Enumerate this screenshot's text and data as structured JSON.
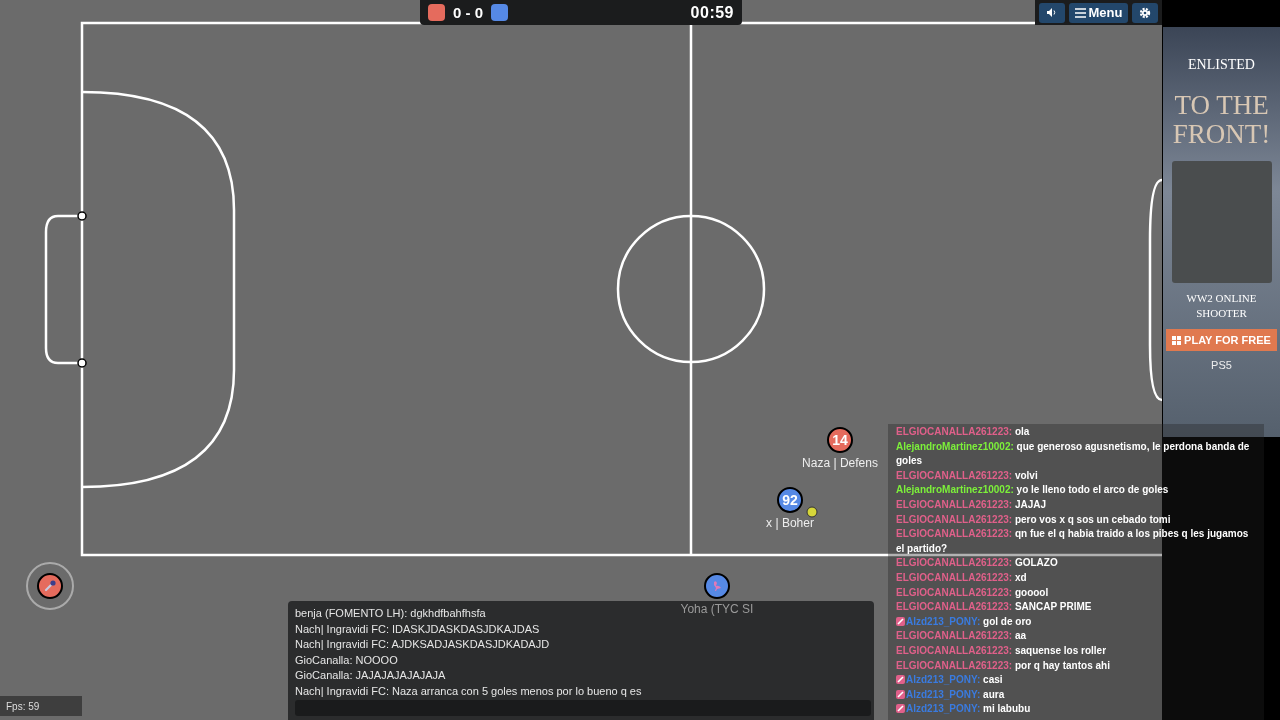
{
  "scoreboard": {
    "red_score": "0",
    "separator": "-",
    "blue_score": "0",
    "time": "00:59"
  },
  "top_buttons": [
    {
      "kind": "sound"
    },
    {
      "kind": "menu",
      "label": "Menu"
    },
    {
      "kind": "settings"
    }
  ],
  "players": [
    {
      "color": "#e56b5d",
      "number": "14",
      "name": "Naza | Defens"
    },
    {
      "color": "#5689e5",
      "number": "92",
      "name": "x | Boher"
    },
    {
      "color": "#5689e5",
      "name": "Yoha (TYC SI"
    },
    {
      "color": "#e56b5d",
      "local": true
    }
  ],
  "ad": {
    "brand": "ENLISTED",
    "headline": "TO THE FRONT!",
    "tagline": "WW2 ONLINE SHOOTER",
    "cta": "PLAY FOR FREE",
    "platform": "PS5"
  },
  "room_chat": [
    {
      "name": "ELGIOCANALLA261223:",
      "text": "ola",
      "color": "#e0608a",
      "badge": false
    },
    {
      "name": "AlejandroMartinez10002:",
      "text": "que generoso agusnetismo, le perdona banda de goles",
      "color": "#7cf03a",
      "badge": false
    },
    {
      "name": "ELGIOCANALLA261223:",
      "text": "volvi",
      "color": "#e0608a",
      "badge": false
    },
    {
      "name": "AlejandroMartinez10002:",
      "text": "yo le lleno todo el arco de goles",
      "color": "#7cf03a",
      "badge": false
    },
    {
      "name": "ELGIOCANALLA261223:",
      "text": "JAJAJ",
      "color": "#e0608a",
      "badge": false
    },
    {
      "name": "ELGIOCANALLA261223:",
      "text": "pero vos x q sos un cebado tomi",
      "color": "#e0608a",
      "badge": false
    },
    {
      "name": "ELGIOCANALLA261223:",
      "text": "qn fue el q habia traido a los pibes q les jugamos el partido?",
      "color": "#e0608a",
      "badge": false
    },
    {
      "name": "ELGIOCANALLA261223:",
      "text": "GOLAZO",
      "color": "#e0608a",
      "badge": false
    },
    {
      "name": "ELGIOCANALLA261223:",
      "text": "xd",
      "color": "#e0608a",
      "badge": false
    },
    {
      "name": "ELGIOCANALLA261223:",
      "text": "gooool",
      "color": "#e0608a",
      "badge": false
    },
    {
      "name": "ELGIOCANALLA261223:",
      "text": "SANCAP PRIME",
      "color": "#e0608a",
      "badge": false
    },
    {
      "name": "Alzd213_PONY:",
      "text": "gol de oro",
      "color": "#3a7be0",
      "badge": true
    },
    {
      "name": "ELGIOCANALLA261223:",
      "text": "aa",
      "color": "#e0608a",
      "badge": false
    },
    {
      "name": "ELGIOCANALLA261223:",
      "text": "saquense los roller",
      "color": "#e0608a",
      "badge": false
    },
    {
      "name": "ELGIOCANALLA261223:",
      "text": "por q hay tantos ahi",
      "color": "#e0608a",
      "badge": false
    },
    {
      "name": "Alzd213_PONY:",
      "text": "casi",
      "color": "#3a7be0",
      "badge": true
    },
    {
      "name": "Alzd213_PONY:",
      "text": "aura",
      "color": "#3a7be0",
      "badge": true
    },
    {
      "name": "Alzd213_PONY:",
      "text": "mi labubu",
      "color": "#3a7be0",
      "badge": true
    }
  ],
  "game_chat": [
    "benja (FOMENTO LH): dgkhdfbahfhsfa",
    "Nach| Ingravidi FC: IDASKJDASKDASJDKAJDAS",
    "Nach| Ingravidi FC: AJDKSADJASKDASJDKADAJD",
    "GioCanalla: NOOOO",
    "GioCanalla: JAJAJAJAJAJAJA",
    "Nach| Ingravidi FC: Naza arranca con 5 goles menos por lo bueno q es"
  ],
  "fps": "Fps: 59"
}
